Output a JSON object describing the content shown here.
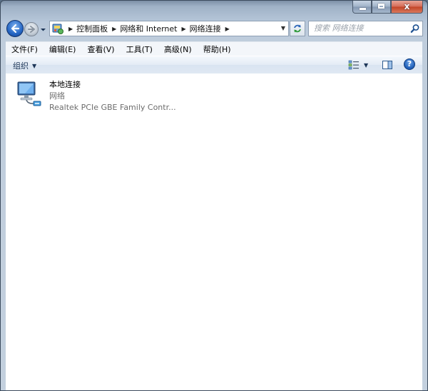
{
  "window": {
    "caption": {
      "minimize": "minimize",
      "maximize": "maximize",
      "close": "x"
    }
  },
  "nav": {
    "breadcrumbs": [
      "控制面板",
      "网络和 Internet",
      "网络连接"
    ],
    "search_placeholder": "搜索 网络连接"
  },
  "menubar": {
    "items": [
      "文件(F)",
      "编辑(E)",
      "查看(V)",
      "工具(T)",
      "高级(N)",
      "帮助(H)"
    ]
  },
  "commandbar": {
    "organize_label": "组织",
    "help_label": "?"
  },
  "connections": [
    {
      "name": "本地连接",
      "status": "网络",
      "device": "Realtek PCIe GBE Family Contr..."
    }
  ],
  "colors": {
    "frame": "#b7c7da",
    "content_bg": "#ffffff",
    "menubar_bg": "#f3f6fa",
    "secondary_text": "#6d6d6d"
  },
  "icons": [
    "back-arrow-icon",
    "forward-arrow-icon",
    "control-panel-icon",
    "refresh-icon",
    "search-icon",
    "views-icon",
    "preview-pane-icon",
    "help-icon",
    "network-connection-icon"
  ]
}
